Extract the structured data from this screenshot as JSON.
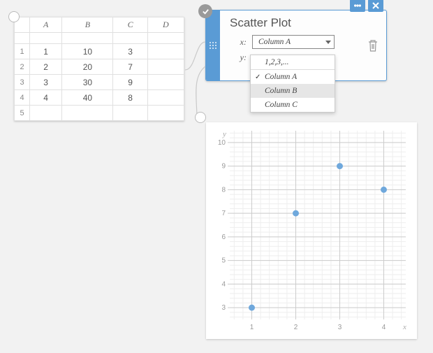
{
  "table": {
    "columns": [
      "A",
      "B",
      "C",
      "D"
    ],
    "rows": [
      {
        "n": "1",
        "cells": [
          "1",
          "10",
          "3",
          ""
        ]
      },
      {
        "n": "2",
        "cells": [
          "2",
          "20",
          "7",
          ""
        ]
      },
      {
        "n": "3",
        "cells": [
          "3",
          "30",
          "9",
          ""
        ]
      },
      {
        "n": "4",
        "cells": [
          "4",
          "40",
          "8",
          ""
        ]
      },
      {
        "n": "5",
        "cells": [
          "",
          "",
          "",
          ""
        ]
      }
    ]
  },
  "scatter": {
    "title": "Scatter Plot",
    "x_label": "x:",
    "y_label": "y:",
    "x_value": "Column A",
    "dropdown": {
      "options": [
        {
          "label": "1,2,3,...",
          "checked": false,
          "hover": false,
          "sep": true
        },
        {
          "label": "Column A",
          "checked": true,
          "hover": false,
          "sep": false
        },
        {
          "label": "Column B",
          "checked": false,
          "hover": true,
          "sep": false
        },
        {
          "label": "Column C",
          "checked": false,
          "hover": false,
          "sep": false
        }
      ]
    }
  },
  "chart_data": {
    "type": "scatter",
    "x": [
      1,
      2,
      3,
      4
    ],
    "y": [
      3,
      7,
      9,
      8
    ],
    "xlabel": "x",
    "ylabel": "y",
    "xlim": [
      0.5,
      4.5
    ],
    "ylim": [
      2.5,
      10.5
    ],
    "xticks": [
      1,
      2,
      3,
      4
    ],
    "yticks": [
      3,
      4,
      5,
      6,
      7,
      8,
      9,
      10
    ]
  }
}
